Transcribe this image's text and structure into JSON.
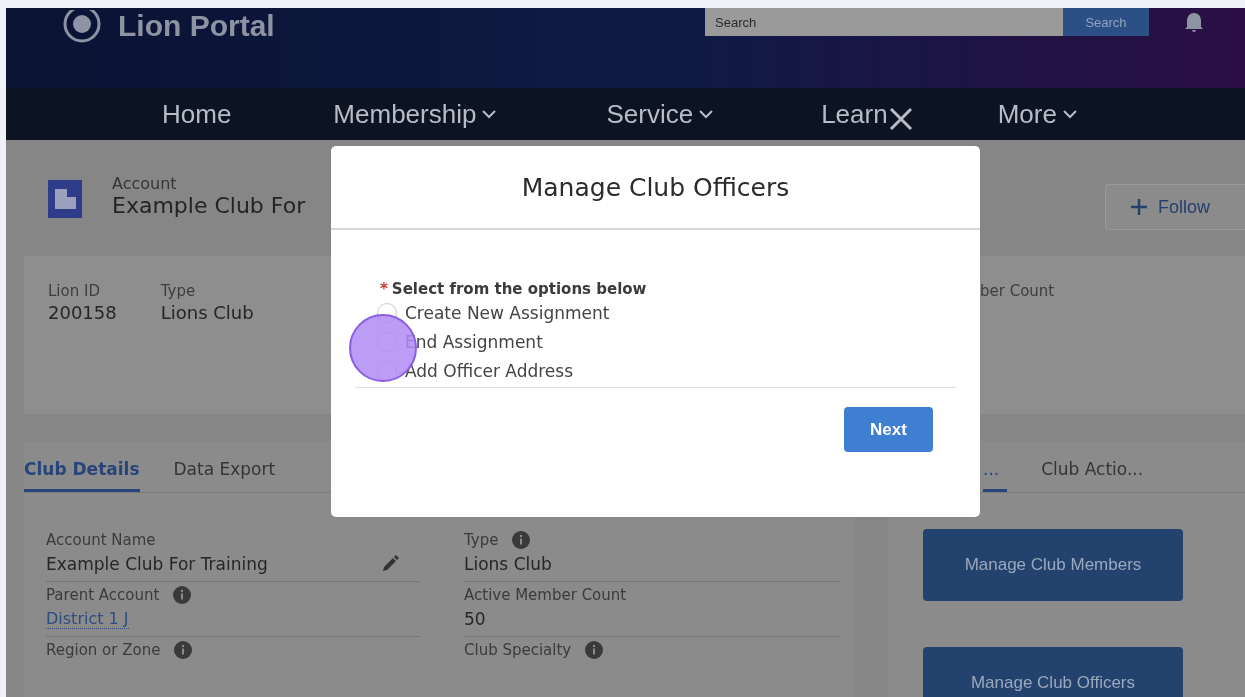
{
  "header": {
    "title": "Lion Portal",
    "search": {
      "placeholder": "Search",
      "button": "Search"
    }
  },
  "nav": [
    {
      "label": "Home",
      "kind": "plain"
    },
    {
      "label": "Membership",
      "kind": "dropdown"
    },
    {
      "label": "Service",
      "kind": "dropdown"
    },
    {
      "label": "Learn",
      "kind": "close"
    },
    {
      "label": "More",
      "kind": "dropdown"
    }
  ],
  "record": {
    "type_label": "Account",
    "name": "Example Club For",
    "follow_button": "Follow"
  },
  "highlights": [
    {
      "label": "Lion ID",
      "value": "200158"
    },
    {
      "label": "Type",
      "value": "Lions Club"
    }
  ],
  "highlights_right": {
    "label": "ber Count"
  },
  "details_tabs": [
    {
      "label": "Club Details",
      "selected": true
    },
    {
      "label": "Data Export",
      "selected": false
    }
  ],
  "fields_left": [
    {
      "label": "Account Name",
      "value": "Example Club For Training",
      "info": false,
      "editable": true,
      "link": false
    },
    {
      "label": "Parent Account",
      "value": "District 1 J",
      "info": true,
      "editable": false,
      "link": true
    },
    {
      "label": "Region or Zone",
      "info": true,
      "editable": false
    }
  ],
  "fields_right": [
    {
      "label": "Type",
      "value": "Lions Club",
      "info": true,
      "editable": false,
      "link": false
    },
    {
      "label": "Active Member Count",
      "value": "50",
      "info": false,
      "editable": false,
      "link": false
    },
    {
      "label": "Club Specialty",
      "info": true,
      "editable": false
    }
  ],
  "actions_tabs": [
    {
      "label": "...",
      "selected": true
    },
    {
      "label": "Club Actio...",
      "selected": false
    }
  ],
  "action_buttons": [
    "Manage Club Members",
    "Manage Club Officers"
  ],
  "modal": {
    "title": "Manage Club Officers",
    "prompt": "Select from the options below",
    "required_mark": "*",
    "options": [
      {
        "label": "Create New Assignment",
        "selected": false
      },
      {
        "label": "End Assignment",
        "selected": false
      },
      {
        "label": "Add Officer Address",
        "selected": false
      }
    ],
    "button": "Next"
  }
}
